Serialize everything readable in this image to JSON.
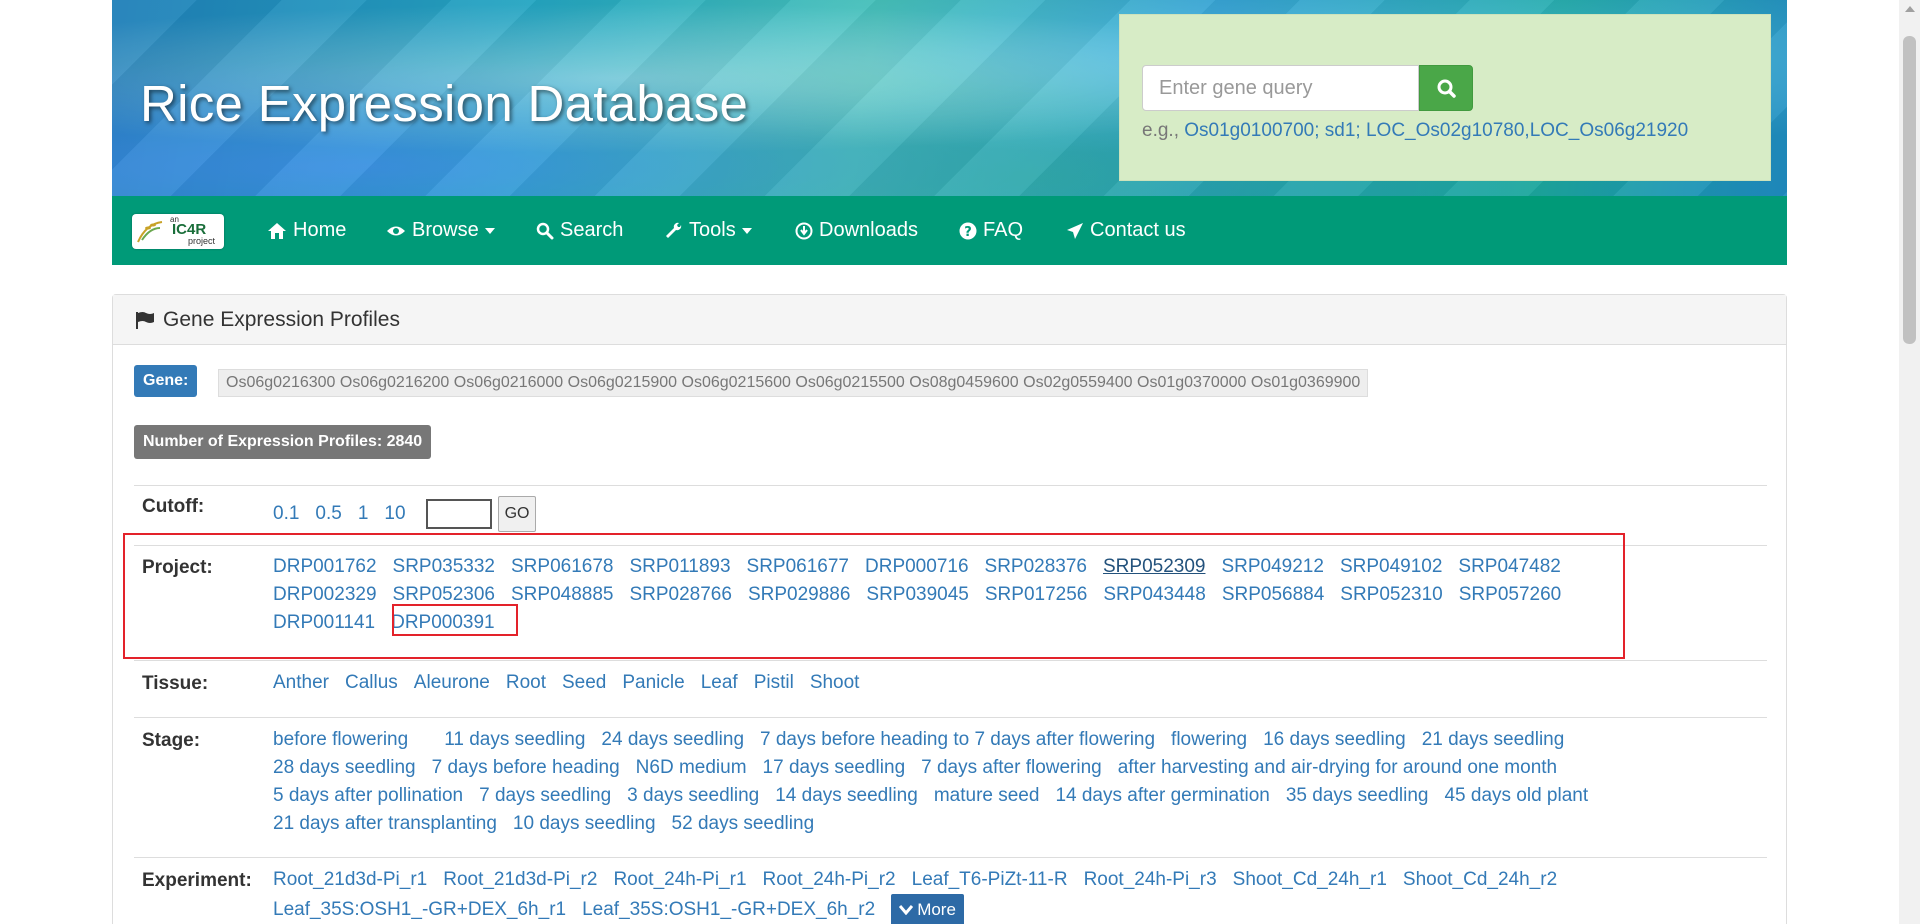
{
  "header": {
    "site_title": "Rice Expression Database",
    "search_placeholder": "Enter gene query",
    "example_prefix": "e.g.,",
    "examples": [
      "Os01g0100700;",
      "sd1;",
      "LOC_Os02g10780,LOC_Os06g21920"
    ]
  },
  "brand": {
    "small": "an",
    "name": "IC4R",
    "sub": "project"
  },
  "nav": [
    {
      "label": "Home",
      "icon": "home-icon"
    },
    {
      "label": "Browse",
      "icon": "eye-icon",
      "dropdown": true
    },
    {
      "label": "Search",
      "icon": "search-icon"
    },
    {
      "label": "Tools",
      "icon": "wrench-icon",
      "dropdown": true
    },
    {
      "label": "Downloads",
      "icon": "download-icon"
    },
    {
      "label": "FAQ",
      "icon": "question-icon"
    },
    {
      "label": "Contact us",
      "icon": "send-icon"
    }
  ],
  "panel": {
    "title": "Gene Expression Profiles",
    "gene_label": "Gene:",
    "genes": "Os06g0216300 Os06g0216200 Os06g0216000 Os06g0215900 Os06g0215600 Os06g0215500 Os08g0459600 Os02g0559400 Os01g0370000 Os01g0369900",
    "profile_count": "Number of Expression Profiles: 2840"
  },
  "cutoff": {
    "label": "Cutoff:",
    "values": [
      "0.1",
      "0.5",
      "1",
      "10"
    ],
    "go": "GO"
  },
  "project": {
    "label": "Project:",
    "rows": [
      [
        "DRP001762",
        "SRP035332",
        "SRP061678",
        "SRP011893",
        "SRP061677",
        "DRP000716",
        "SRP028376",
        "SRP052309",
        "SRP049212",
        "SRP049102",
        "SRP047482"
      ],
      [
        "DRP002329",
        "SRP052306",
        "SRP048885",
        "SRP028766",
        "SRP029886",
        "SRP039045",
        "SRP017256",
        "SRP043448",
        "SRP056884",
        "SRP052310",
        "SRP057260"
      ],
      [
        "DRP001141",
        "DRP000391"
      ]
    ]
  },
  "tissue": {
    "label": "Tissue:",
    "values": [
      "Anther",
      "Callus",
      "Aleurone",
      "Root",
      "Seed",
      "Panicle",
      "Leaf",
      "Pistil",
      "Shoot"
    ]
  },
  "stage": {
    "label": "Stage:",
    "rows": [
      [
        "before flowering",
        "11 days seedling",
        "24 days seedling",
        "7 days before heading to 7 days after flowering",
        "flowering",
        "16 days seedling",
        "21 days seedling"
      ],
      [
        "28 days seedling",
        "7 days before heading",
        "N6D medium",
        "17 days seedling",
        "7 days after flowering",
        "after harvesting and air-drying for around one month"
      ],
      [
        "5 days after pollination",
        "7 days seedling",
        "3 days seedling",
        "14 days seedling",
        "mature seed",
        "14 days after germination",
        "35 days seedling",
        "45 days old plant"
      ],
      [
        "21 days after transplanting",
        "10 days seedling",
        "52 days seedling"
      ]
    ]
  },
  "experiment": {
    "label": "Experiment:",
    "rows": [
      [
        "Root_21d3d-Pi_r1",
        "Root_21d3d-Pi_r2",
        "Root_24h-Pi_r1",
        "Root_24h-Pi_r2",
        "Leaf_T6-PiZt-11-R",
        "Root_24h-Pi_r3",
        "Shoot_Cd_24h_r1",
        "Shoot_Cd_24h_r2"
      ],
      [
        "Leaf_35S:OSH1_-GR+DEX_6h_r1",
        "Leaf_35S:OSH1_-GR+DEX_6h_r2"
      ]
    ],
    "more": "More"
  },
  "colors": {
    "nav_bg": "#009a78",
    "link": "#337ab7",
    "highlight": "#e3222a",
    "search_btn": "#4aa748"
  }
}
